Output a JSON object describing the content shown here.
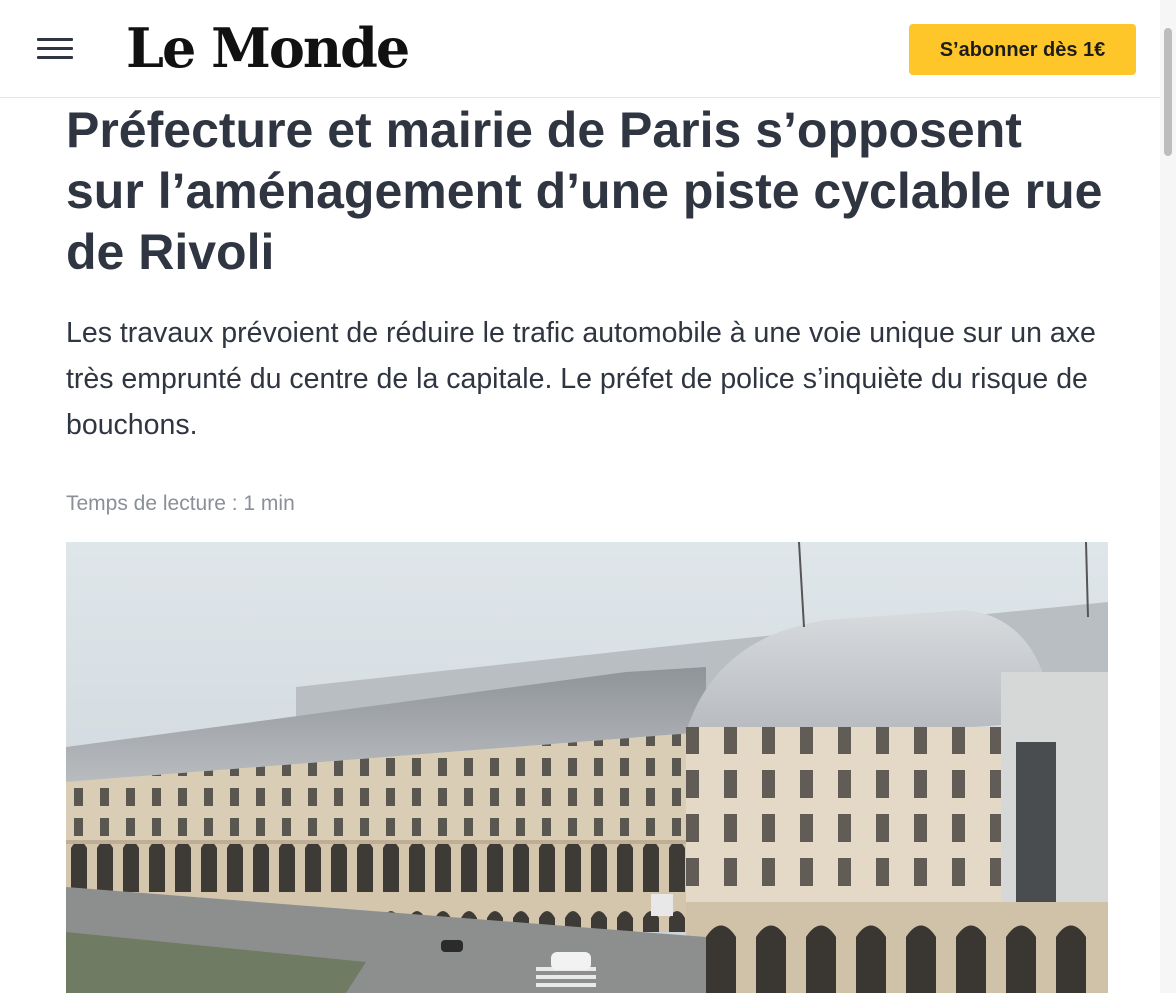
{
  "header": {
    "logo": "Le Monde",
    "subscribe_label": "S’abonner dès 1€"
  },
  "article": {
    "title": "Préfecture et mairie de Paris s’opposent sur l’aménagement d’une piste cyclable rue de Rivoli",
    "standfirst": "Les travaux prévoient de réduire le trafic automobile à une voie unique sur un axe très emprunté du centre de la capitale. Le préfet de police s’inquiète du risque de bouchons.",
    "reading_time": "Temps de lecture : 1 min"
  },
  "icons": {
    "menu": "hamburger-menu-icon"
  },
  "colors": {
    "accent": "#ffc629",
    "text": "#2f3541",
    "muted": "#8a8f98"
  }
}
